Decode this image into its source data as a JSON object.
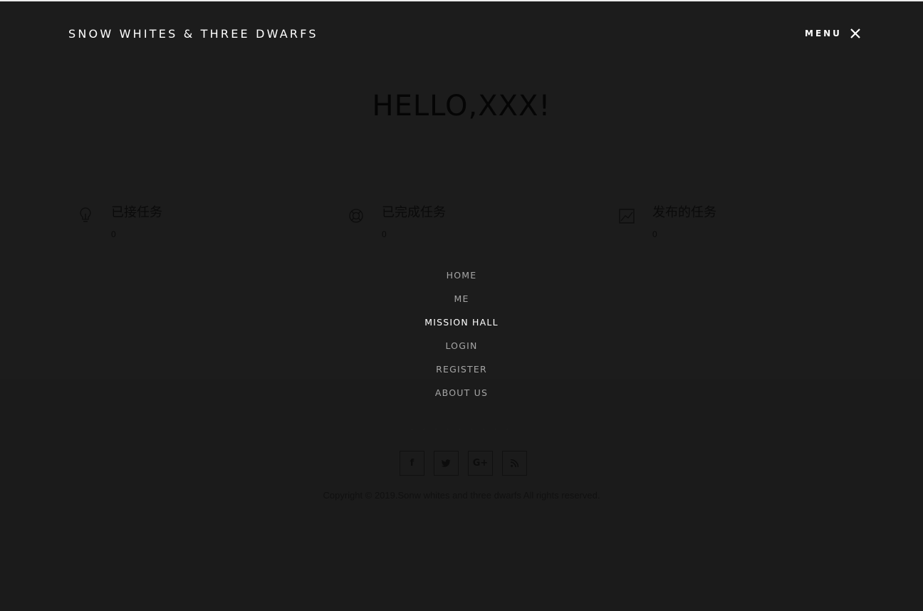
{
  "header": {
    "brand": "SNOW WHITES & THREE DWARFS",
    "menu_label": "MENU",
    "close_icon": "close-icon"
  },
  "hero": {
    "greeting": "HELLO,XXX!"
  },
  "stats": [
    {
      "icon": "lightbulb-icon",
      "title": "已接任务",
      "count": "0"
    },
    {
      "icon": "lifebuoy-icon",
      "title": "已完成任务",
      "count": "0"
    },
    {
      "icon": "chart-icon",
      "title": "发布的任务",
      "count": "0"
    }
  ],
  "nav": {
    "items": [
      {
        "label": "HOME",
        "active": false
      },
      {
        "label": "ME",
        "active": false
      },
      {
        "label": "MISSION HALL",
        "active": true
      },
      {
        "label": "LOGIN",
        "active": false
      },
      {
        "label": "REGISTER",
        "active": false
      },
      {
        "label": "ABOUT US",
        "active": false
      }
    ]
  },
  "footer": {
    "socials": [
      {
        "icon": "facebook-icon",
        "glyph": "f"
      },
      {
        "icon": "twitter-icon",
        "glyph": "✦"
      },
      {
        "icon": "google-plus-icon",
        "glyph": "G+"
      },
      {
        "icon": "rss-icon",
        "glyph": "◣"
      }
    ],
    "copyright": "Copyright © 2019.Sonw whites and three dwarfs All rights reserved."
  },
  "colors": {
    "background": "#1b1b1b",
    "active_nav": "#ffffff",
    "nav": "#a6a6a6"
  }
}
